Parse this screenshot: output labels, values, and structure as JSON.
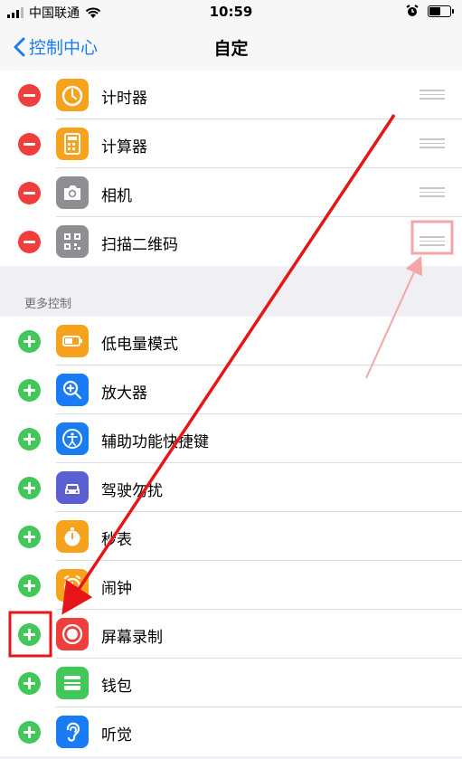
{
  "status": {
    "carrier": "中国联通",
    "time": "10:59"
  },
  "nav": {
    "back_label": "控制中心",
    "title": "自定"
  },
  "included": [
    {
      "label": "计时器",
      "icon": "timer-icon",
      "color": "#f7a21c"
    },
    {
      "label": "计算器",
      "icon": "calculator-icon",
      "color": "#f7a21c"
    },
    {
      "label": "相机",
      "icon": "camera-icon",
      "color": "#8e8e93"
    },
    {
      "label": "扫描二维码",
      "icon": "qr-code-icon",
      "color": "#8e8e93"
    }
  ],
  "more_section_title": "更多控制",
  "more": [
    {
      "label": "低电量模式",
      "icon": "battery-icon",
      "color": "#f7a21c"
    },
    {
      "label": "放大器",
      "icon": "magnifier-icon",
      "color": "#1a7cf5"
    },
    {
      "label": "辅助功能快捷键",
      "icon": "accessibility-icon",
      "color": "#1a7cf5"
    },
    {
      "label": "驾驶勿扰",
      "icon": "car-icon",
      "color": "#5a5fd1"
    },
    {
      "label": "秒表",
      "icon": "stopwatch-icon",
      "color": "#f7a21c"
    },
    {
      "label": "闹钟",
      "icon": "alarm-icon",
      "color": "#f7a21c"
    },
    {
      "label": "屏幕录制",
      "icon": "screen-record-icon",
      "color": "#ef3e3b"
    },
    {
      "label": "钱包",
      "icon": "wallet-icon",
      "color": "#42c759"
    },
    {
      "label": "听觉",
      "icon": "ear-icon",
      "color": "#1a7cf5"
    }
  ],
  "colors": {
    "accent": "#1a7cf5",
    "remove": "#ef3e3b",
    "add": "#42c759",
    "annotation": "#e5151a"
  }
}
